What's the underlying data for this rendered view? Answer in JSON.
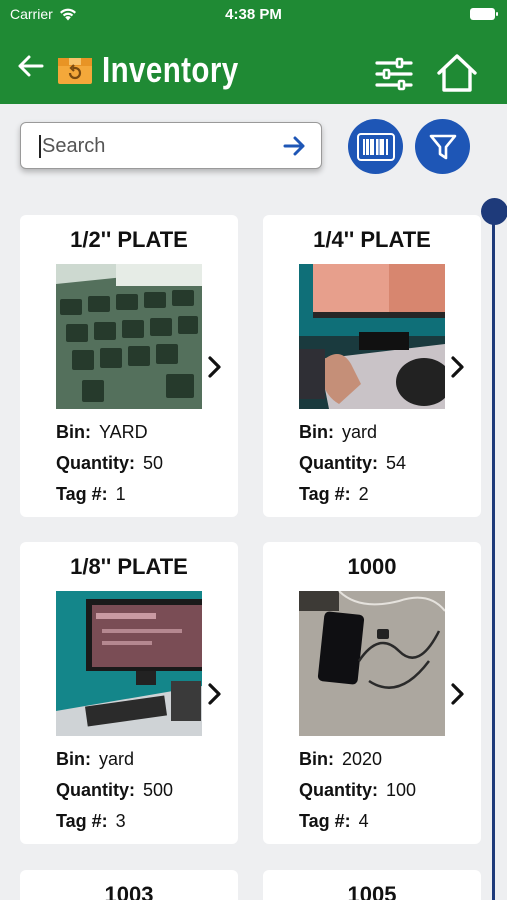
{
  "status_bar": {
    "carrier": "Carrier",
    "time": "4:38 PM"
  },
  "header": {
    "title": "Inventory"
  },
  "search": {
    "placeholder": "Search",
    "value": ""
  },
  "labels": {
    "bin": "Bin:",
    "quantity": "Quantity:",
    "tag": "Tag #:"
  },
  "items": [
    {
      "title": "1/2'' PLATE",
      "bin": "YARD",
      "quantity": "50",
      "tag": "1"
    },
    {
      "title": "1/4'' PLATE",
      "bin": "yard",
      "quantity": "54",
      "tag": "2"
    },
    {
      "title": "1/8'' PLATE",
      "bin": "yard",
      "quantity": "500",
      "tag": "3"
    },
    {
      "title": "1000",
      "bin": "2020",
      "quantity": "100",
      "tag": "4"
    },
    {
      "title": "1003"
    },
    {
      "title": "1005"
    }
  ],
  "colors": {
    "header_green": "#1f8a34",
    "accent_blue": "#1e56b6",
    "scroll_navy": "#1e3a7a"
  }
}
